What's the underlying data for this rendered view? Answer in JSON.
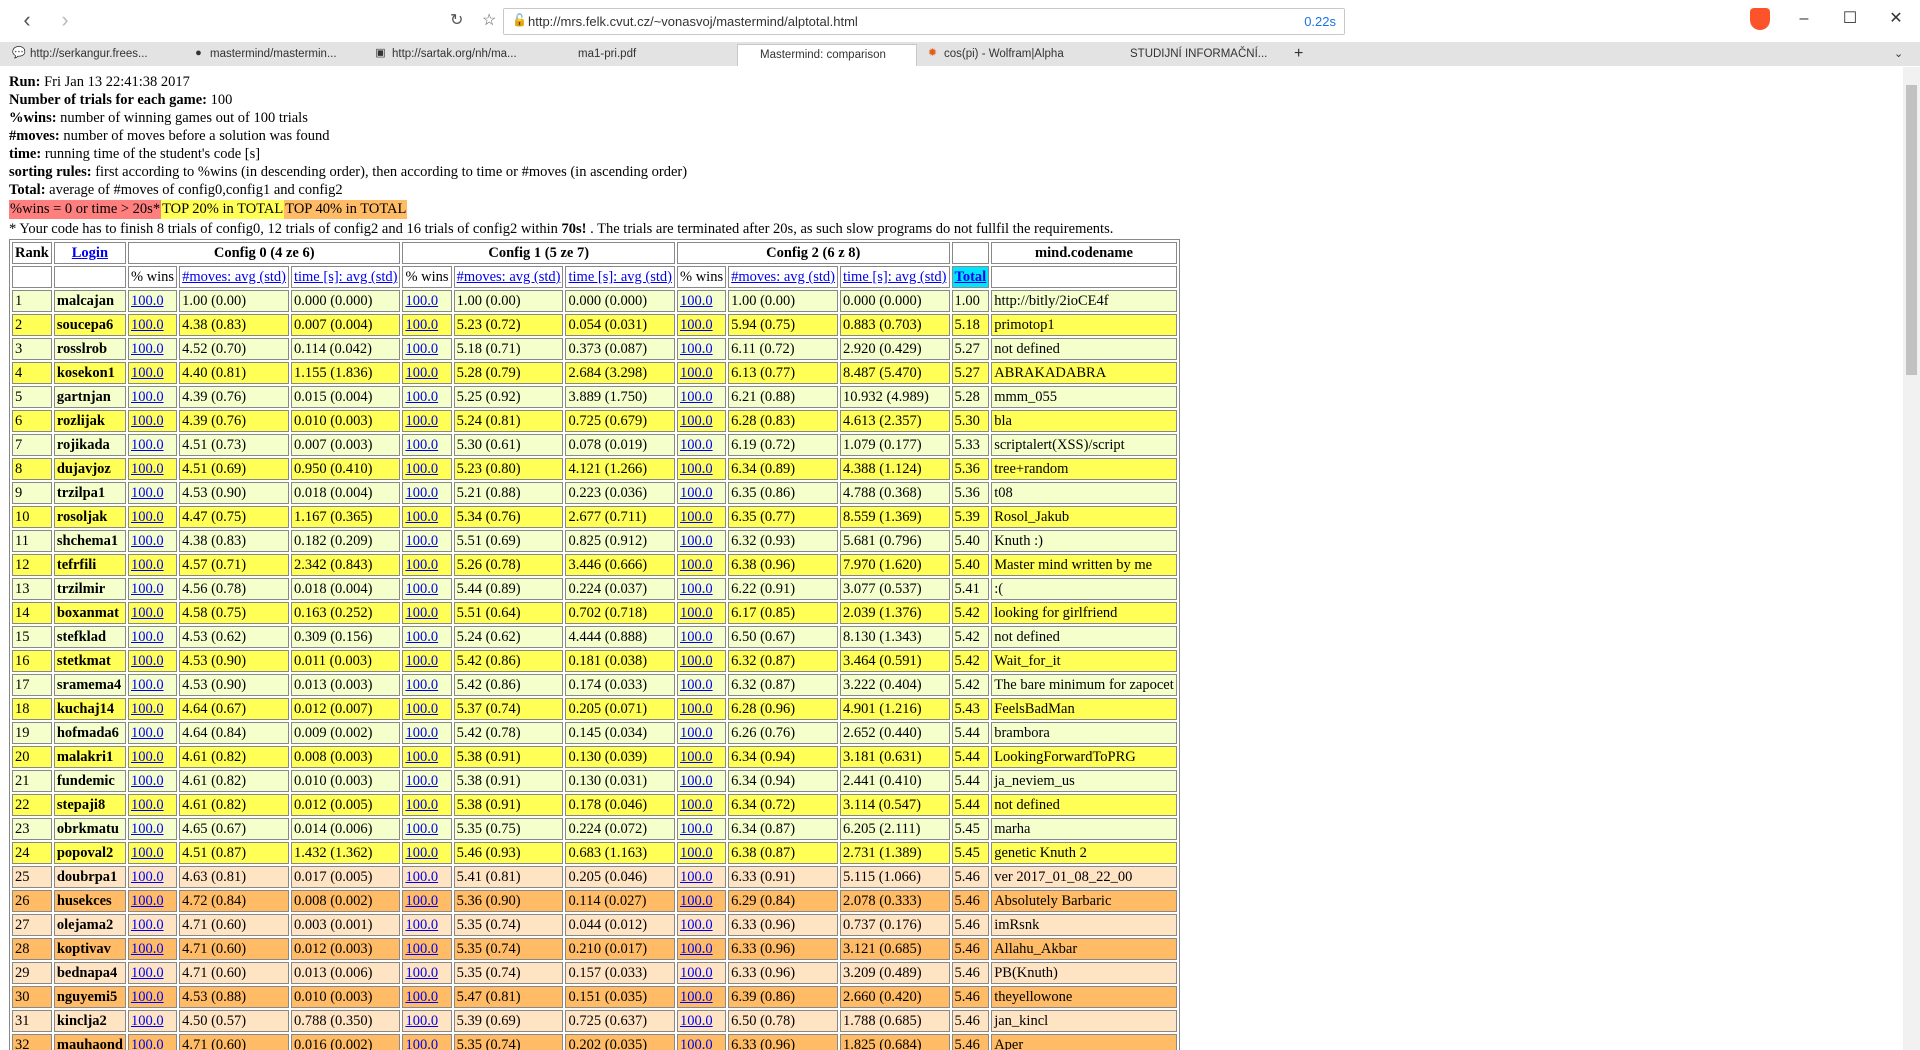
{
  "browser": {
    "url": "http://mrs.felk.cvut.cz/~vonasvoj/mastermind/alptotal.html",
    "load_time": "0.22s",
    "tabs": [
      {
        "label": "http://serkangur.frees...",
        "icon": "bubble-icon"
      },
      {
        "label": "mastermind/mastermin...",
        "icon": "github-icon"
      },
      {
        "label": "http://sartak.org/nh/ma...",
        "icon": "image-icon"
      },
      {
        "label": "ma1-pri.pdf",
        "icon": ""
      },
      {
        "label": "Mastermind: comparison",
        "icon": ""
      },
      {
        "label": "cos(pi) - Wolfram|Alpha",
        "icon": "wolfram-icon"
      },
      {
        "label": "STUDIJNÍ INFORMAČNÍ...",
        "icon": ""
      }
    ]
  },
  "info": {
    "run_label": "Run:",
    "run_value": " Fri Jan 13 22:41:38 2017",
    "trials_label": "Number of trials for each game:",
    "trials_value": " 100",
    "wins_label": "%wins:",
    "wins_value": " number of winning games out of 100 trials",
    "moves_label": "#moves:",
    "moves_value": " number of moves before a solution was found",
    "time_label": "time:",
    "time_value": " running time of the student's code [s]",
    "sort_label": "sorting rules:",
    "sort_value": " first according to %wins (in descending order), then according to time or #moves (in ascending order)",
    "total_label": "Total:",
    "total_value": " average of #moves of config0,config1 and config2"
  },
  "legend": {
    "red": "%wins = 0 or time > 20s*",
    "yellow": "TOP 20% in TOTAL",
    "orange": "TOP 40% in TOTAL"
  },
  "note": {
    "part1": "* Your code has to finish 8 trials of config0, 12 trials of config2 and 16 trials of config2 within ",
    "bold": "70s!",
    "part2": " . The trials are terminated after 20s, as such slow programs do not fullfil the requirements."
  },
  "table": {
    "headers": {
      "rank": "Rank",
      "login": "Login",
      "config0": "Config 0 (4 ze 6)",
      "config1": "Config 1 (5 ze 7)",
      "config2": "Config 2 (6 z 8)",
      "codename": "mind.codename"
    },
    "subheaders": {
      "wins": "% wins",
      "moves": "#moves: avg (std)",
      "time": "time [s]: avg (std)",
      "total": "Total"
    },
    "rows": [
      [
        "1",
        "malcajan",
        "100.0",
        "1.00 (0.00)",
        "0.000 (0.000)",
        "100.0",
        "1.00 (0.00)",
        "0.000 (0.000)",
        "100.0",
        "1.00 (0.00)",
        "0.000 (0.000)",
        "1.00",
        "http://bitly/2ioCE4f"
      ],
      [
        "2",
        "soucepa6",
        "100.0",
        "4.38 (0.83)",
        "0.007 (0.004)",
        "100.0",
        "5.23 (0.72)",
        "0.054 (0.031)",
        "100.0",
        "5.94 (0.75)",
        "0.883 (0.703)",
        "5.18",
        "primotop1"
      ],
      [
        "3",
        "rosslrob",
        "100.0",
        "4.52 (0.70)",
        "0.114 (0.042)",
        "100.0",
        "5.18 (0.71)",
        "0.373 (0.087)",
        "100.0",
        "6.11 (0.72)",
        "2.920 (0.429)",
        "5.27",
        "not defined"
      ],
      [
        "4",
        "kosekon1",
        "100.0",
        "4.40 (0.81)",
        "1.155 (1.836)",
        "100.0",
        "5.28 (0.79)",
        "2.684 (3.298)",
        "100.0",
        "6.13 (0.77)",
        "8.487 (5.470)",
        "5.27",
        "ABRAKADABRA"
      ],
      [
        "5",
        "gartnjan",
        "100.0",
        "4.39 (0.76)",
        "0.015 (0.004)",
        "100.0",
        "5.25 (0.92)",
        "3.889 (1.750)",
        "100.0",
        "6.21 (0.88)",
        "10.932 (4.989)",
        "5.28",
        "mmm_055"
      ],
      [
        "6",
        "rozlijak",
        "100.0",
        "4.39 (0.76)",
        "0.010 (0.003)",
        "100.0",
        "5.24 (0.81)",
        "0.725 (0.679)",
        "100.0",
        "6.28 (0.83)",
        "4.613 (2.357)",
        "5.30",
        "bla"
      ],
      [
        "7",
        "rojikada",
        "100.0",
        "4.51 (0.73)",
        "0.007 (0.003)",
        "100.0",
        "5.30 (0.61)",
        "0.078 (0.019)",
        "100.0",
        "6.19 (0.72)",
        "1.079 (0.177)",
        "5.33",
        "scriptalert(XSS)/script"
      ],
      [
        "8",
        "dujavjoz",
        "100.0",
        "4.51 (0.69)",
        "0.950 (0.410)",
        "100.0",
        "5.23 (0.80)",
        "4.121 (1.266)",
        "100.0",
        "6.34 (0.89)",
        "4.388 (1.124)",
        "5.36",
        "tree+random"
      ],
      [
        "9",
        "trzilpa1",
        "100.0",
        "4.53 (0.90)",
        "0.018 (0.004)",
        "100.0",
        "5.21 (0.88)",
        "0.223 (0.036)",
        "100.0",
        "6.35 (0.86)",
        "4.788 (0.368)",
        "5.36",
        "t08"
      ],
      [
        "10",
        "rosoljak",
        "100.0",
        "4.47 (0.75)",
        "1.167 (0.365)",
        "100.0",
        "5.34 (0.76)",
        "2.677 (0.711)",
        "100.0",
        "6.35 (0.77)",
        "8.559 (1.369)",
        "5.39",
        "Rosol_Jakub"
      ],
      [
        "11",
        "shchema1",
        "100.0",
        "4.38 (0.83)",
        "0.182 (0.209)",
        "100.0",
        "5.51 (0.69)",
        "0.825 (0.912)",
        "100.0",
        "6.32 (0.93)",
        "5.681 (0.796)",
        "5.40",
        "Knuth :)"
      ],
      [
        "12",
        "tefrfili",
        "100.0",
        "4.57 (0.71)",
        "2.342 (0.843)",
        "100.0",
        "5.26 (0.78)",
        "3.446 (0.666)",
        "100.0",
        "6.38 (0.96)",
        "7.970 (1.620)",
        "5.40",
        "Master mind written by me"
      ],
      [
        "13",
        "trzilmir",
        "100.0",
        "4.56 (0.78)",
        "0.018 (0.004)",
        "100.0",
        "5.44 (0.89)",
        "0.224 (0.037)",
        "100.0",
        "6.22 (0.91)",
        "3.077 (0.537)",
        "5.41",
        ":("
      ],
      [
        "14",
        "boxanmat",
        "100.0",
        "4.58 (0.75)",
        "0.163 (0.252)",
        "100.0",
        "5.51 (0.64)",
        "0.702 (0.718)",
        "100.0",
        "6.17 (0.85)",
        "2.039 (1.376)",
        "5.42",
        "looking for girlfriend"
      ],
      [
        "15",
        "stefklad",
        "100.0",
        "4.53 (0.62)",
        "0.309 (0.156)",
        "100.0",
        "5.24 (0.62)",
        "4.444 (0.888)",
        "100.0",
        "6.50 (0.67)",
        "8.130 (1.343)",
        "5.42",
        "not defined"
      ],
      [
        "16",
        "stetkmat",
        "100.0",
        "4.53 (0.90)",
        "0.011 (0.003)",
        "100.0",
        "5.42 (0.86)",
        "0.181 (0.038)",
        "100.0",
        "6.32 (0.87)",
        "3.464 (0.591)",
        "5.42",
        "Wait_for_it"
      ],
      [
        "17",
        "sramema4",
        "100.0",
        "4.53 (0.90)",
        "0.013 (0.003)",
        "100.0",
        "5.42 (0.86)",
        "0.174 (0.033)",
        "100.0",
        "6.32 (0.87)",
        "3.222 (0.404)",
        "5.42",
        "The bare minimum for zapocet"
      ],
      [
        "18",
        "kuchaj14",
        "100.0",
        "4.64 (0.67)",
        "0.012 (0.007)",
        "100.0",
        "5.37 (0.74)",
        "0.205 (0.071)",
        "100.0",
        "6.28 (0.96)",
        "4.901 (1.216)",
        "5.43",
        "FeelsBadMan"
      ],
      [
        "19",
        "hofmada6",
        "100.0",
        "4.64 (0.84)",
        "0.009 (0.002)",
        "100.0",
        "5.42 (0.78)",
        "0.145 (0.034)",
        "100.0",
        "6.26 (0.76)",
        "2.652 (0.440)",
        "5.44",
        "brambora"
      ],
      [
        "20",
        "malakri1",
        "100.0",
        "4.61 (0.82)",
        "0.008 (0.003)",
        "100.0",
        "5.38 (0.91)",
        "0.130 (0.039)",
        "100.0",
        "6.34 (0.94)",
        "3.181 (0.631)",
        "5.44",
        "LookingForwardToPRG"
      ],
      [
        "21",
        "fundemic",
        "100.0",
        "4.61 (0.82)",
        "0.010 (0.003)",
        "100.0",
        "5.38 (0.91)",
        "0.130 (0.031)",
        "100.0",
        "6.34 (0.94)",
        "2.441 (0.410)",
        "5.44",
        "ja_neviem_us"
      ],
      [
        "22",
        "stepaji8",
        "100.0",
        "4.61 (0.82)",
        "0.012 (0.005)",
        "100.0",
        "5.38 (0.91)",
        "0.178 (0.046)",
        "100.0",
        "6.34 (0.72)",
        "3.114 (0.547)",
        "5.44",
        "not defined"
      ],
      [
        "23",
        "obrkmatu",
        "100.0",
        "4.65 (0.67)",
        "0.014 (0.006)",
        "100.0",
        "5.35 (0.75)",
        "0.224 (0.072)",
        "100.0",
        "6.34 (0.87)",
        "6.205 (2.111)",
        "5.45",
        "marha"
      ],
      [
        "24",
        "popoval2",
        "100.0",
        "4.51 (0.87)",
        "1.432 (1.362)",
        "100.0",
        "5.46 (0.93)",
        "0.683 (1.163)",
        "100.0",
        "6.38 (0.87)",
        "2.731 (1.389)",
        "5.45",
        "genetic Knuth 2"
      ],
      [
        "25",
        "doubrpa1",
        "100.0",
        "4.63 (0.81)",
        "0.017 (0.005)",
        "100.0",
        "5.41 (0.81)",
        "0.205 (0.046)",
        "100.0",
        "6.33 (0.91)",
        "5.115 (1.066)",
        "5.46",
        "ver 2017_01_08_22_00"
      ],
      [
        "26",
        "husekces",
        "100.0",
        "4.72 (0.84)",
        "0.008 (0.002)",
        "100.0",
        "5.36 (0.90)",
        "0.114 (0.027)",
        "100.0",
        "6.29 (0.84)",
        "2.078 (0.333)",
        "5.46",
        "Absolutely Barbaric"
      ],
      [
        "27",
        "olejama2",
        "100.0",
        "4.71 (0.60)",
        "0.003 (0.001)",
        "100.0",
        "5.35 (0.74)",
        "0.044 (0.012)",
        "100.0",
        "6.33 (0.96)",
        "0.737 (0.176)",
        "5.46",
        "imRsnk"
      ],
      [
        "28",
        "koptivav",
        "100.0",
        "4.71 (0.60)",
        "0.012 (0.003)",
        "100.0",
        "5.35 (0.74)",
        "0.210 (0.017)",
        "100.0",
        "6.33 (0.96)",
        "3.121 (0.685)",
        "5.46",
        "Allahu_Akbar"
      ],
      [
        "29",
        "bednapa4",
        "100.0",
        "4.71 (0.60)",
        "0.013 (0.006)",
        "100.0",
        "5.35 (0.74)",
        "0.157 (0.033)",
        "100.0",
        "6.33 (0.96)",
        "3.209 (0.489)",
        "5.46",
        "PB(Knuth)"
      ],
      [
        "30",
        "nguyemi5",
        "100.0",
        "4.53 (0.88)",
        "0.010 (0.003)",
        "100.0",
        "5.47 (0.81)",
        "0.151 (0.035)",
        "100.0",
        "6.39 (0.86)",
        "2.660 (0.420)",
        "5.46",
        "theyellowone"
      ],
      [
        "31",
        "kinclja2",
        "100.0",
        "4.50 (0.57)",
        "0.788 (0.350)",
        "100.0",
        "5.39 (0.69)",
        "0.725 (0.637)",
        "100.0",
        "6.50 (0.78)",
        "1.788 (0.685)",
        "5.46",
        "jan_kincl"
      ],
      [
        "32",
        "mauhaond",
        "100.0",
        "4.71 (0.60)",
        "0.016 (0.002)",
        "100.0",
        "5.35 (0.74)",
        "0.202 (0.035)",
        "100.0",
        "6.33 (0.96)",
        "1.825 (0.684)",
        "5.46",
        "Aper"
      ]
    ],
    "row_colors": [
      "c0",
      "c1",
      "c0",
      "c1",
      "c0",
      "c1",
      "c0",
      "c1",
      "c0",
      "c1",
      "c0",
      "c1",
      "c0",
      "c1",
      "c0",
      "c1",
      "c0",
      "c1",
      "c0",
      "c1",
      "c0",
      "c1",
      "c0",
      "c1",
      "c2",
      "c3",
      "c2",
      "c3",
      "c2",
      "c3",
      "c2",
      "c3"
    ]
  }
}
